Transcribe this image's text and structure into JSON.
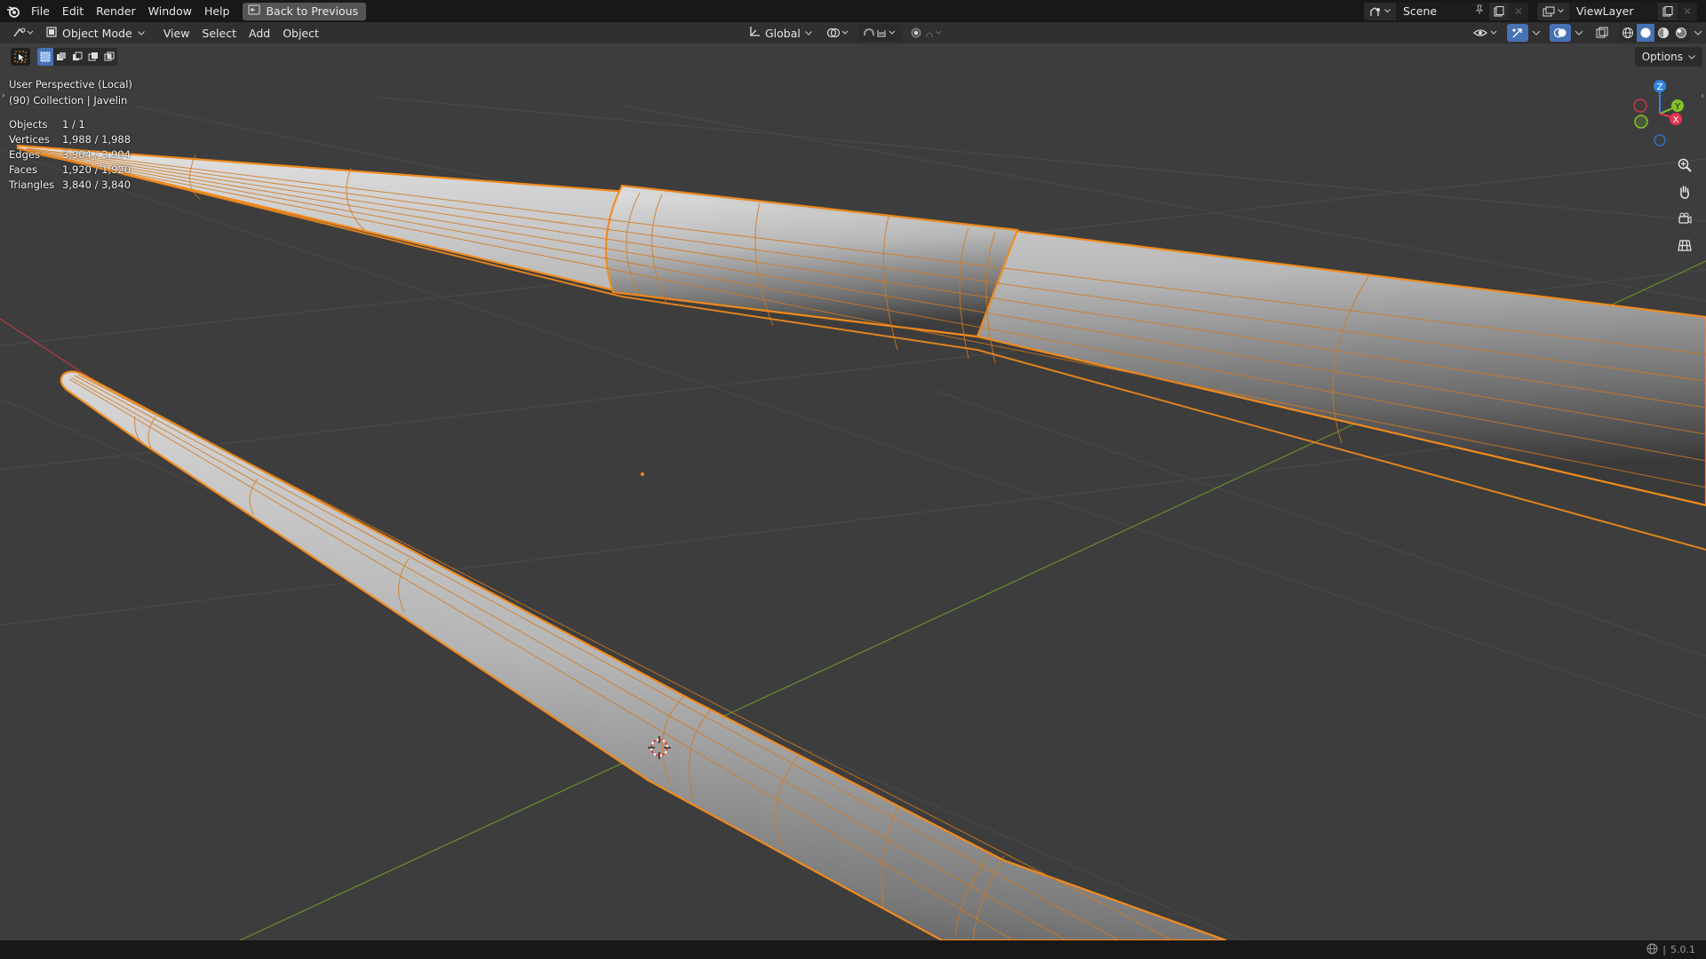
{
  "menubar": {
    "items": [
      "File",
      "Edit",
      "Render",
      "Window",
      "Help"
    ],
    "back_button": "Back to Previous",
    "scene_name": "Scene",
    "view_layer": "ViewLayer"
  },
  "header": {
    "mode": "Object Mode",
    "menus": [
      "View",
      "Select",
      "Add",
      "Object"
    ],
    "orientation": "Global",
    "options_label": "Options"
  },
  "overlay": {
    "perspective": "User Perspective (Local)",
    "collection": "(90) Collection | Javelin"
  },
  "stats": [
    {
      "label": "Objects",
      "value": "1 / 1"
    },
    {
      "label": "Vertices",
      "value": "1,988 / 1,988"
    },
    {
      "label": "Edges",
      "value": "3,904 / 3,904"
    },
    {
      "label": "Faces",
      "value": "1,920 / 1,920"
    },
    {
      "label": "Triangles",
      "value": "3,840 / 3,840"
    }
  ],
  "gizmo": {
    "z": "Z",
    "y": "Y",
    "x": "X"
  },
  "status": {
    "version": "5.0.1"
  },
  "colors": {
    "accent": "#4772b3",
    "selection_orange": "#f28a1c",
    "axis_x": "#e8344e",
    "axis_y": "#83c22a",
    "axis_z": "#2f83e8"
  },
  "icons": [
    "blender-logo-icon",
    "back-icon",
    "scene-icon",
    "pin-icon",
    "new-scene-icon",
    "view-layer-icon",
    "editor-type-icon",
    "object-mode-icon",
    "orientation-icon",
    "pivot-icon",
    "snap-icon",
    "proportional-icon",
    "visibility-icon",
    "gizmo-icon",
    "overlay-icon",
    "xray-icon",
    "wireframe-shading-icon",
    "solid-shading-icon",
    "material-shading-icon",
    "rendered-shading-icon",
    "zoom-icon",
    "pan-hand-icon",
    "camera-view-icon",
    "ortho-grid-icon",
    "language-icon"
  ]
}
